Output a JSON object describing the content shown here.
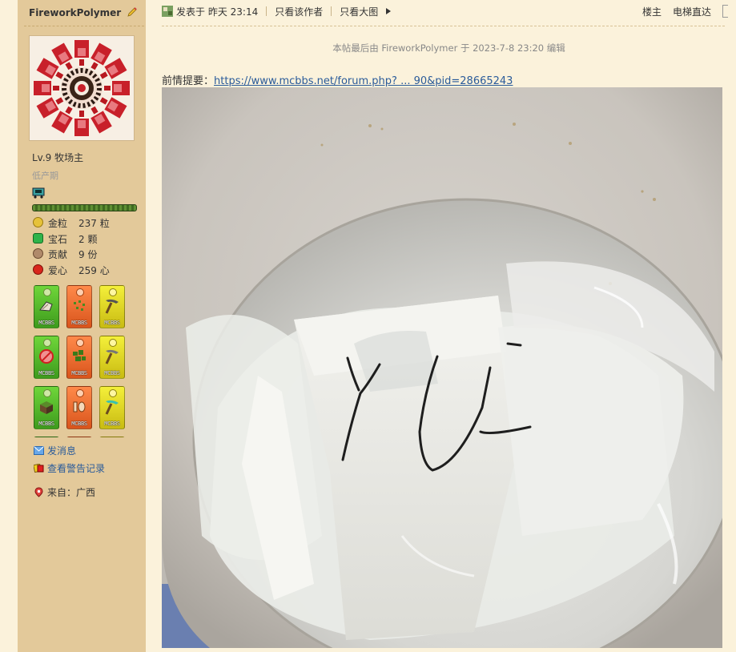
{
  "author": {
    "name": "FireworkPolymer",
    "level": "Lv.9 牧场主",
    "rank": "低产期"
  },
  "stats": [
    {
      "label": "金粒",
      "value": "237 粒",
      "icon": "gold-nugget-icon",
      "color": "#e6c23a"
    },
    {
      "label": "宝石",
      "value": "2 颗",
      "icon": "emerald-icon",
      "color": "#2fb34a"
    },
    {
      "label": "贡献",
      "value": "9 份",
      "icon": "contribution-icon",
      "color": "#b08a6a"
    },
    {
      "label": "爱心",
      "value": "259 心",
      "icon": "apple-heart-icon",
      "color": "#d8261c"
    }
  ],
  "medal_label": "MCBBS",
  "sidebar_links": {
    "message": "发消息",
    "warnings": "查看警告记录",
    "from": "来自：广西"
  },
  "post_header": {
    "posted": "发表于 昨天 23:14",
    "only_author": "只看该作者",
    "large_image": "只看大图",
    "floor": "楼主",
    "elevator": "电梯直达"
  },
  "edit_note": "本帖最后由 FireworkPolymer 于 2023-7-8 23:20 编辑",
  "prefix_label": "前情提要：",
  "prefix_link": "https://www.mcbbs.net/forum.php? ... 90&pid=28665243",
  "photo_text": "YU",
  "colors": {
    "sidebar": "#e3c99a",
    "page": "#fbf2db",
    "link": "#2a5b9a"
  }
}
